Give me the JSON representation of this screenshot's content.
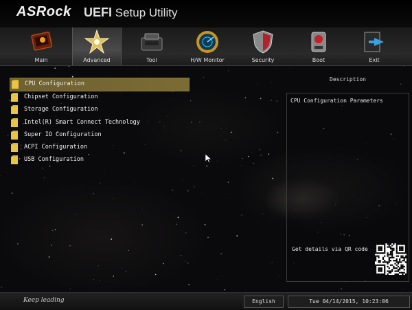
{
  "header": {
    "brand": "ASRock",
    "title_bold": "UEFI",
    "title_rest": " Setup Utility"
  },
  "tabs": [
    {
      "label": "Main",
      "icon": "main-icon"
    },
    {
      "label": "Advanced",
      "icon": "star-icon",
      "active": true
    },
    {
      "label": "Tool",
      "icon": "toolbox-icon"
    },
    {
      "label": "H/W Monitor",
      "icon": "radar-icon"
    },
    {
      "label": "Security",
      "icon": "shield-icon"
    },
    {
      "label": "Boot",
      "icon": "power-icon"
    },
    {
      "label": "Exit",
      "icon": "exit-icon"
    }
  ],
  "menu": {
    "items": [
      {
        "label": "CPU Configuration",
        "selected": true
      },
      {
        "label": "Chipset Configuration"
      },
      {
        "label": "Storage Configuration"
      },
      {
        "label": "Intel(R) Smart Connect Technology"
      },
      {
        "label": "Super IO Configuration"
      },
      {
        "label": "ACPI Configuration"
      },
      {
        "label": "USB Configuration"
      }
    ]
  },
  "description": {
    "title": "Description",
    "text": "CPU Configuration Parameters",
    "qr_label": "Get details via QR code"
  },
  "footer": {
    "slogan": "Keep leading",
    "language": "English",
    "datetime": "Tue 04/14/2015, 10:23:06"
  },
  "colors": {
    "selected_bg": "#7b6c35",
    "folder": "#d9b431",
    "background": "#0a0a0c"
  }
}
